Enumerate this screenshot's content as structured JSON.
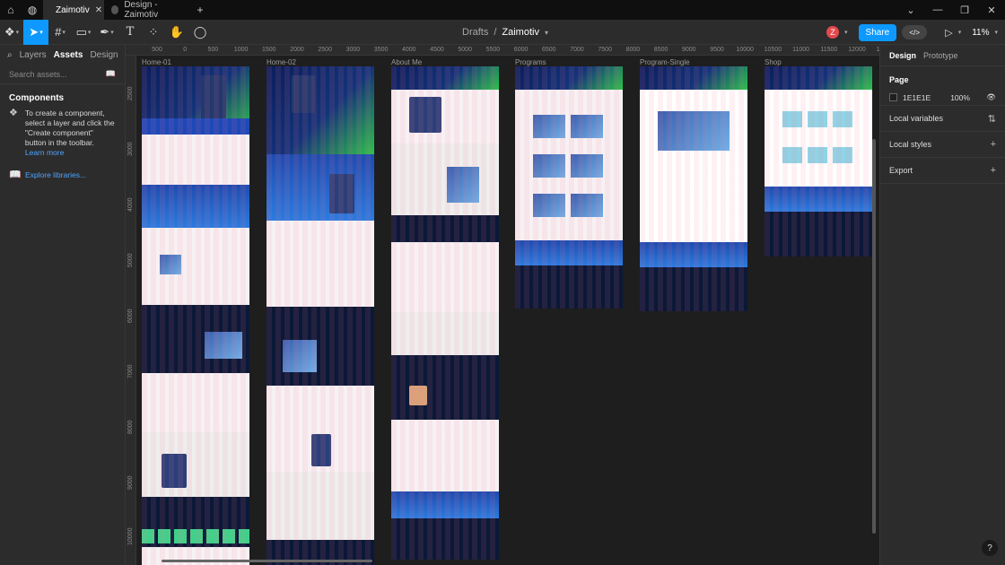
{
  "titlebar": {
    "tabs": [
      {
        "label": "Zaimotiv",
        "close": "✕",
        "active": true
      },
      {
        "label": "Design - Zaimotiv",
        "active": false
      }
    ],
    "new_tab": "+",
    "window_controls": [
      "⌄",
      "—",
      "❐",
      "✕"
    ]
  },
  "toolbar": {
    "breadcrumb_project": "Drafts",
    "breadcrumb_sep": "/",
    "breadcrumb_file": "Zaimotiv",
    "avatar_initial": "Z",
    "share_label": "Share",
    "devmode_icon": "</>",
    "zoom": "11%"
  },
  "left_panel": {
    "tab_layers": "Layers",
    "tab_assets": "Assets",
    "mode_label": "Design",
    "search_placeholder": "Search assets...",
    "components_heading": "Components",
    "components_help": "To create a component, select a layer and click the \"Create component\" button in the toolbar.",
    "learn_more": "Learn more",
    "explore_libraries": "Explore libraries..."
  },
  "ruler": {
    "h_ticks": [
      "500",
      "0",
      "500",
      "1000",
      "1500",
      "2000",
      "2500",
      "3000",
      "3500",
      "4000",
      "4500",
      "5000",
      "5500",
      "6000",
      "6500",
      "7000",
      "7500",
      "8000",
      "8500",
      "9000",
      "9500",
      "10000",
      "10500",
      "11000",
      "11500",
      "12000",
      "12500",
      "13000"
    ],
    "v_ticks": [
      "2500",
      "3000",
      "4000",
      "5000",
      "6000",
      "7000",
      "8000",
      "9000",
      "10000"
    ]
  },
  "frames": [
    {
      "label": "Home-01"
    },
    {
      "label": "Home-02"
    },
    {
      "label": "About Me"
    },
    {
      "label": "Programs"
    },
    {
      "label": "Program-Single"
    },
    {
      "label": "Shop"
    }
  ],
  "right_panel": {
    "tab_design": "Design",
    "tab_prototype": "Prototype",
    "page_heading": "Page",
    "page_color": "1E1E1E",
    "page_opacity": "100%",
    "local_variables": "Local variables",
    "local_styles": "Local styles",
    "export": "Export",
    "help": "?"
  },
  "colors": {
    "accent": "#0d99ff",
    "canvas_bg": "#1e1e1e",
    "panel_bg": "#2c2c2c"
  }
}
